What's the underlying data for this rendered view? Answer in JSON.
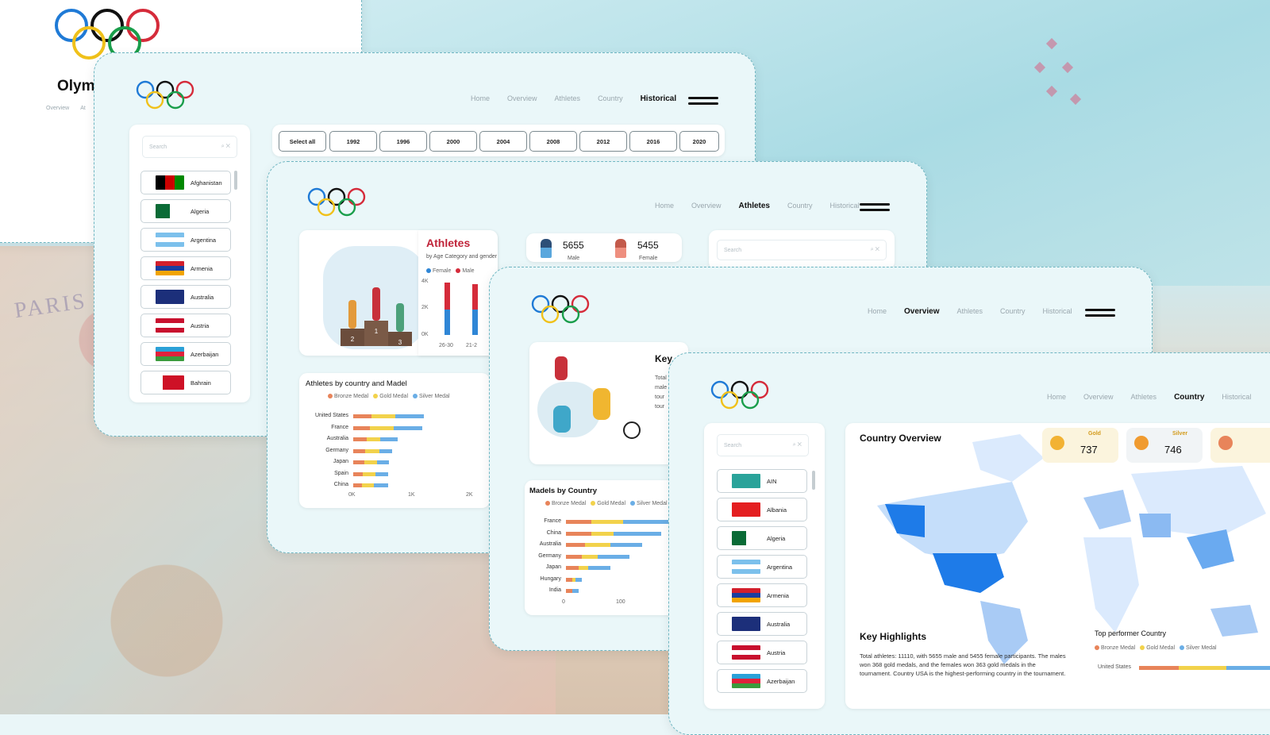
{
  "background": {
    "text": "PARIS"
  },
  "card_back": {
    "title": "Olym",
    "nav": [
      "Overview",
      "At"
    ]
  },
  "card_historical": {
    "nav": [
      "Home",
      "Overview",
      "Athletes",
      "Country",
      "Historical"
    ],
    "active": "Historical",
    "search_placeholder": "Search",
    "years": [
      "Select all",
      "1992",
      "1996",
      "2000",
      "2004",
      "2008",
      "2012",
      "2016",
      "2020"
    ],
    "countries": [
      "Afghanistan",
      "Algeria",
      "Argentina",
      "Armenia",
      "Australia",
      "Austria",
      "Azerbaijan",
      "Bahrain"
    ]
  },
  "card_athletes": {
    "nav": [
      "Home",
      "Overview",
      "Athletes",
      "Country",
      "Historical"
    ],
    "active": "Athletes",
    "title": "Athletes",
    "subtitle": "by Age Category and gender",
    "male_count": "5655",
    "male_label": "Male",
    "female_count": "5455",
    "female_label": "Female",
    "search_placeholder": "Search",
    "podium": [
      "2",
      "1",
      "3"
    ],
    "age_chart": {
      "legend": [
        "Female",
        "Male"
      ],
      "y_ticks": [
        "4K",
        "2K",
        "0K"
      ],
      "x_ticks": [
        "26-30",
        "21-2"
      ]
    },
    "country_chart_title": "Athletes by country and Madel",
    "legend": [
      "Bronze Medal",
      "Gold Medal",
      "Silver Medal"
    ],
    "x_ticks": [
      "0K",
      "1K",
      "2K"
    ]
  },
  "card_overview": {
    "nav": [
      "Home",
      "Overview",
      "Athletes",
      "Country",
      "Historical"
    ],
    "active": "Overview",
    "key_title": "Key",
    "key_text": [
      "Total",
      "male",
      "tour",
      "tour"
    ],
    "madels_title": "Madels by Country",
    "legend": [
      "Bronze Medal",
      "Gold Medal",
      "Silver Medal"
    ],
    "x_ticks": [
      "0",
      "100"
    ]
  },
  "card_country": {
    "nav": [
      "Home",
      "Overview",
      "Athletes",
      "Country",
      "Historical"
    ],
    "active": "Country",
    "search_placeholder": "Search",
    "countries": [
      "AIN",
      "Albania",
      "Algeria",
      "Argentina",
      "Armenia",
      "Australia",
      "Austria",
      "Azerbaijan"
    ],
    "overview_title": "Country Overview",
    "gold_label": "Gold",
    "gold_value": "737",
    "silver_label": "Silver",
    "silver_value": "746",
    "highlights_title": "Key Highlights",
    "highlights_text": "Total athletes: 11110, with 5655 male and 5455 female participants. The males won 368 gold medals, and the females won 363 gold medals in the tournament. Country USA is the highest-performing country in the tournament.",
    "top_title": "Top performer Country",
    "legend": [
      "Bronze Medal",
      "Gold Medal",
      "Silver Medal"
    ],
    "top_country": "United States"
  },
  "colors": {
    "bronze": "#e8845a",
    "gold": "#f2d24b",
    "silver": "#6aaee6",
    "female": "#2f86d6",
    "male": "#d52b3a",
    "accent": "#c0243a"
  },
  "chart_data": [
    {
      "type": "bar",
      "orientation": "horizontal",
      "title": "Athletes by country and Madel",
      "categories": [
        "United States",
        "France",
        "Australia",
        "Germany",
        "Japan",
        "Spain",
        "China"
      ],
      "series": [
        {
          "name": "Bronze Medal",
          "values": [
            320,
            300,
            240,
            210,
            200,
            170,
            160
          ]
        },
        {
          "name": "Gold Medal",
          "values": [
            420,
            420,
            240,
            250,
            220,
            220,
            200
          ]
        },
        {
          "name": "Silver Medal",
          "values": [
            510,
            500,
            300,
            230,
            210,
            230,
            250
          ]
        }
      ],
      "x_ticks": [
        "0K",
        "1K",
        "2K"
      ]
    },
    {
      "type": "bar",
      "orientation": "horizontal",
      "title": "Madels by Country",
      "categories": [
        "France",
        "China",
        "Australia",
        "Germany",
        "Japan",
        "Hungary",
        "India"
      ],
      "series": [
        {
          "name": "Bronze Medal",
          "values": [
            40,
            40,
            30,
            25,
            20,
            10,
            10
          ]
        },
        {
          "name": "Gold Medal",
          "values": [
            50,
            35,
            40,
            25,
            15,
            5,
            0
          ]
        },
        {
          "name": "Silver Medal",
          "values": [
            75,
            75,
            50,
            50,
            35,
            10,
            10
          ]
        }
      ],
      "x_ticks": [
        "0",
        "100"
      ]
    },
    {
      "type": "bar",
      "title": "Athletes",
      "categories": [
        "26-30",
        "21-2"
      ],
      "series": [
        {
          "name": "Female",
          "values": [
            1700,
            1800
          ]
        },
        {
          "name": "Male",
          "values": [
            1900,
            1700
          ]
        }
      ],
      "y_ticks": [
        "4K",
        "2K",
        "0K"
      ]
    }
  ]
}
